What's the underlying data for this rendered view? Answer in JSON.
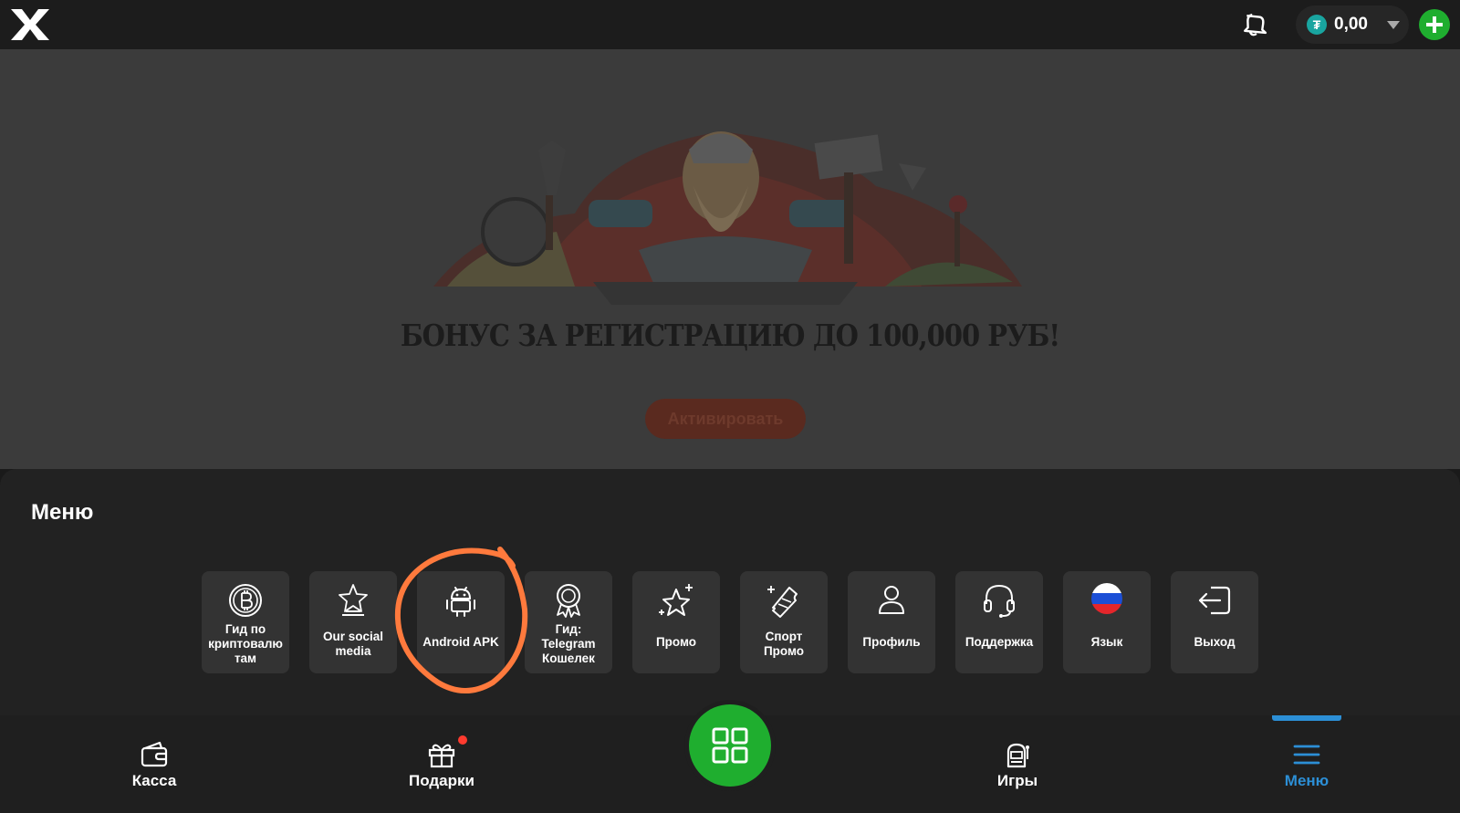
{
  "header": {
    "logo": "X",
    "notifications_icon": "bell-icon",
    "balance": {
      "currency_icon": "tether-icon",
      "currency_symbol": "₮",
      "value": "0,00"
    },
    "add_icon": "plus-icon"
  },
  "promo": {
    "title": "БОНУС ЗА РЕГИСТРАЦИЮ ДО 100,000 РУБ!",
    "button_label": "Активировать"
  },
  "menu": {
    "title": "Меню",
    "items": [
      {
        "label_lines": [
          "Гид по",
          "криптовалю",
          "там"
        ],
        "icon": "bitcoin-icon"
      },
      {
        "label_lines": [
          "Our social",
          "media"
        ],
        "icon": "star-trophy-icon"
      },
      {
        "label_lines": [
          "Android APK"
        ],
        "icon": "android-icon"
      },
      {
        "label_lines": [
          "Гид:",
          "Telegram",
          "Кошелек"
        ],
        "icon": "award-badge-icon"
      },
      {
        "label_lines": [
          "Промо"
        ],
        "icon": "sparkle-star-icon"
      },
      {
        "label_lines": [
          "Спорт",
          "Промо"
        ],
        "icon": "ticket-icon"
      },
      {
        "label_lines": [
          "Профиль"
        ],
        "icon": "user-icon"
      },
      {
        "label_lines": [
          "Поддержка"
        ],
        "icon": "headset-icon"
      },
      {
        "label_lines": [
          "Язык"
        ],
        "icon": "russia-flag-icon"
      },
      {
        "label_lines": [
          "Выход"
        ],
        "icon": "logout-icon"
      }
    ]
  },
  "bottom_nav": {
    "items": [
      {
        "label": "Касса",
        "icon": "wallet-icon"
      },
      {
        "label": "Подарки",
        "icon": "gift-icon",
        "has_badge": true
      },
      {
        "label": "",
        "icon": "grid-icon"
      },
      {
        "label": "Игры",
        "icon": "slot-machine-icon"
      },
      {
        "label": "Меню",
        "icon": "hamburger-menu-icon",
        "active": true
      }
    ]
  },
  "colors": {
    "accent_green": "#1fae2f",
    "active_blue": "#2c8fd6",
    "annotation_orange": "#ff7a3d",
    "badge_red": "#ff3b2f"
  }
}
